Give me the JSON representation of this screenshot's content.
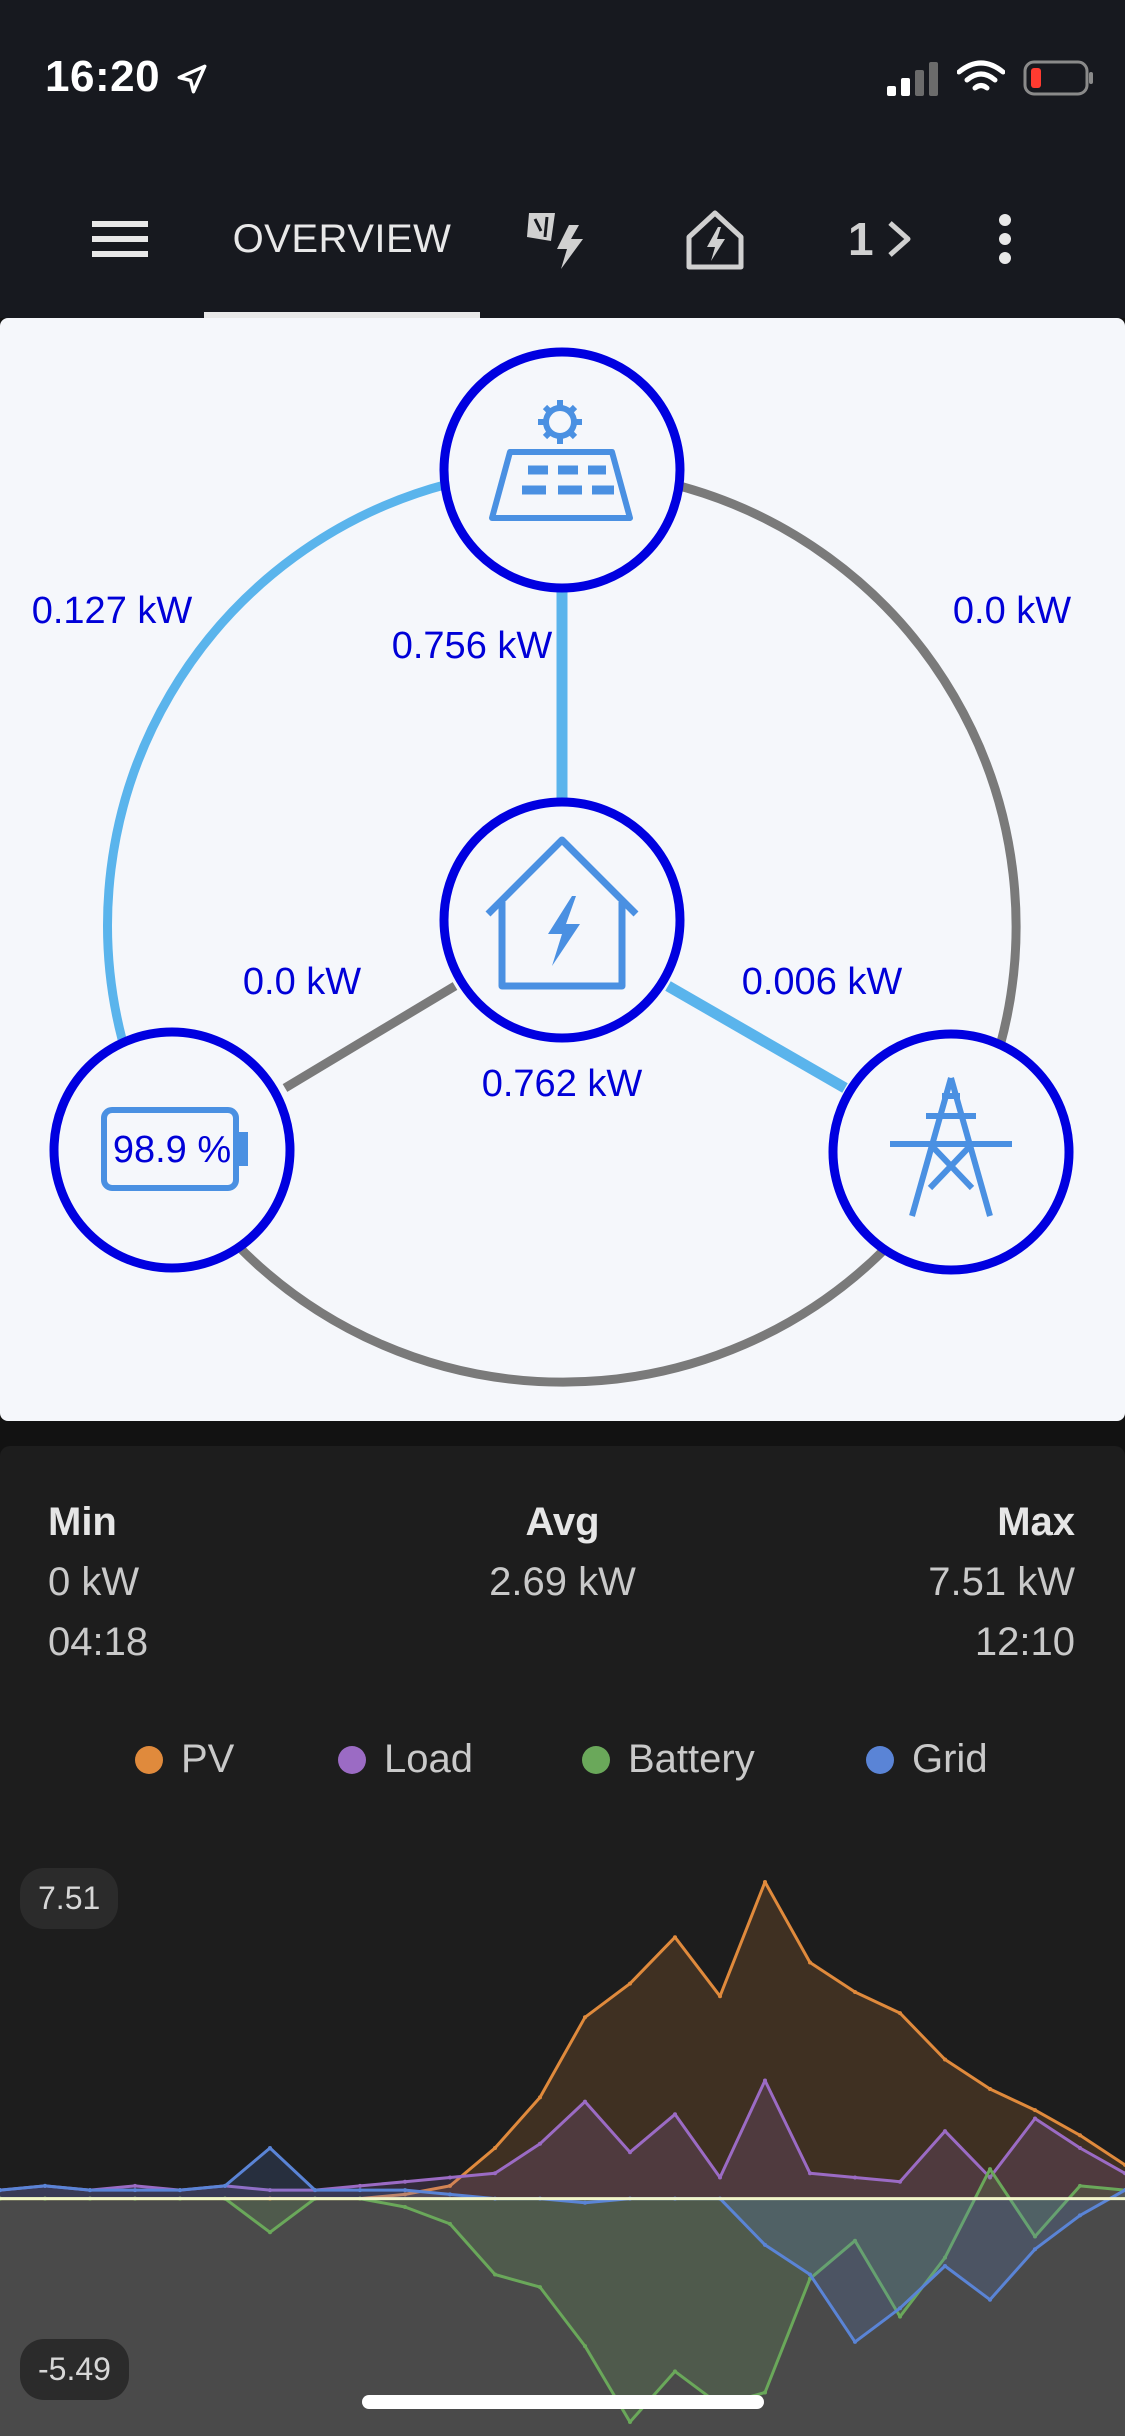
{
  "status_bar": {
    "time": "16:20",
    "location_icon": "location-arrow-icon",
    "signal_icon": "cellular-signal-icon",
    "wifi_icon": "wifi-icon",
    "battery_icon": "battery-low-icon"
  },
  "header": {
    "menu_icon": "hamburger-menu-icon",
    "tabs": [
      {
        "label": "OVERVIEW",
        "active": true
      },
      {
        "icon": "solar-energy-icon"
      },
      {
        "icon": "home-energy-icon"
      },
      {
        "label": "1",
        "icon": "chevron-right-icon"
      }
    ],
    "more_icon": "more-vertical-icon"
  },
  "flow": {
    "pv_to_battery": "0.127 kW",
    "pv_to_home": "0.756 kW",
    "pv_to_grid": "0.0 kW",
    "battery_to_home": "0.0 kW",
    "grid_to_home": "0.006 kW",
    "home_load": "0.762 kW",
    "battery_soc": "98.9 %",
    "colors": {
      "node": "#0000e0",
      "active_line": "#5ab4ec",
      "inactive_line": "#7a7a7a",
      "label": "#0000d8"
    }
  },
  "stats": {
    "min": {
      "label": "Min",
      "value": "0 kW",
      "time": "04:18"
    },
    "avg": {
      "label": "Avg",
      "value": "2.69 kW"
    },
    "max": {
      "label": "Max",
      "value": "7.51 kW",
      "time": "12:10"
    }
  },
  "legend": [
    {
      "label": "PV",
      "color": "#e08a3c"
    },
    {
      "label": "Load",
      "color": "#9b6bc4"
    },
    {
      "label": "Battery",
      "color": "#6aa85a"
    },
    {
      "label": "Grid",
      "color": "#5a84d6"
    }
  ],
  "chart_data": {
    "type": "area",
    "y_max_label": "7.51",
    "y_min_label": "-5.49",
    "ylim": [
      -5.49,
      7.51
    ],
    "x": [
      0,
      4,
      8,
      12,
      16,
      20,
      24,
      28,
      32,
      36,
      40,
      44,
      48,
      52,
      56,
      60,
      64,
      68,
      72,
      76,
      80,
      84,
      88,
      92,
      96,
      100
    ],
    "series": [
      {
        "name": "PV",
        "color": "#e08a3c",
        "values": [
          0,
          0,
          0,
          0,
          0,
          0,
          0,
          0,
          0,
          0.1,
          0.3,
          1.2,
          2.4,
          4.3,
          5.1,
          6.2,
          4.8,
          7.51,
          5.6,
          4.9,
          4.4,
          3.3,
          2.6,
          2.1,
          1.5,
          0.8
        ]
      },
      {
        "name": "Load",
        "color": "#9b6bc4",
        "values": [
          0.2,
          0.3,
          0.2,
          0.3,
          0.2,
          0.3,
          0.2,
          0.2,
          0.3,
          0.4,
          0.5,
          0.6,
          1.3,
          2.3,
          1.1,
          2.0,
          0.5,
          2.8,
          0.6,
          0.5,
          0.4,
          1.6,
          0.5,
          1.9,
          1.2,
          0.6
        ]
      },
      {
        "name": "Battery",
        "color": "#6aa85a",
        "values": [
          0,
          0,
          0,
          0,
          0,
          0,
          -0.8,
          0,
          0,
          -0.2,
          -0.6,
          -1.8,
          -2.1,
          -3.5,
          -5.3,
          -4.1,
          -4.9,
          -4.6,
          -1.9,
          -1.0,
          -2.8,
          -1.4,
          0.7,
          -0.9,
          0.3,
          0.2
        ]
      },
      {
        "name": "Grid",
        "color": "#5a84d6",
        "values": [
          0.2,
          0.3,
          0.2,
          0.2,
          0.2,
          0.3,
          1.2,
          0.2,
          0.2,
          0.2,
          0.1,
          0,
          0,
          -0.1,
          0,
          0,
          0,
          -1.1,
          -1.8,
          -3.4,
          -2.6,
          -1.6,
          -2.4,
          -1.2,
          -0.4,
          0.2
        ]
      }
    ]
  }
}
